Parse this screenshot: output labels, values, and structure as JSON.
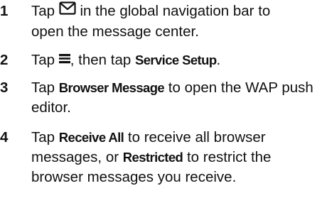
{
  "steps": [
    {
      "number": "1",
      "line1_pre": "Tap",
      "icon": "envelope-icon",
      "line1_post": "in the global navigation bar to",
      "line2": "open the message center."
    },
    {
      "number": "2",
      "pre": "Tap",
      "icon": "menu-icon",
      "mid": ", then tap",
      "ui": "Service Setup",
      "post": "."
    },
    {
      "number": "3",
      "pre": "Tap",
      "ui": "Browser Message",
      "post": "to open the WAP push",
      "line2": "editor."
    },
    {
      "number": "4",
      "pre": "Tap",
      "ui1": "Receive All",
      "mid": "to receive all browser",
      "line2_pre": "messages, or",
      "ui2": "Restricted",
      "line2_post": "to restrict the",
      "line3": "browser messages you receive."
    }
  ]
}
